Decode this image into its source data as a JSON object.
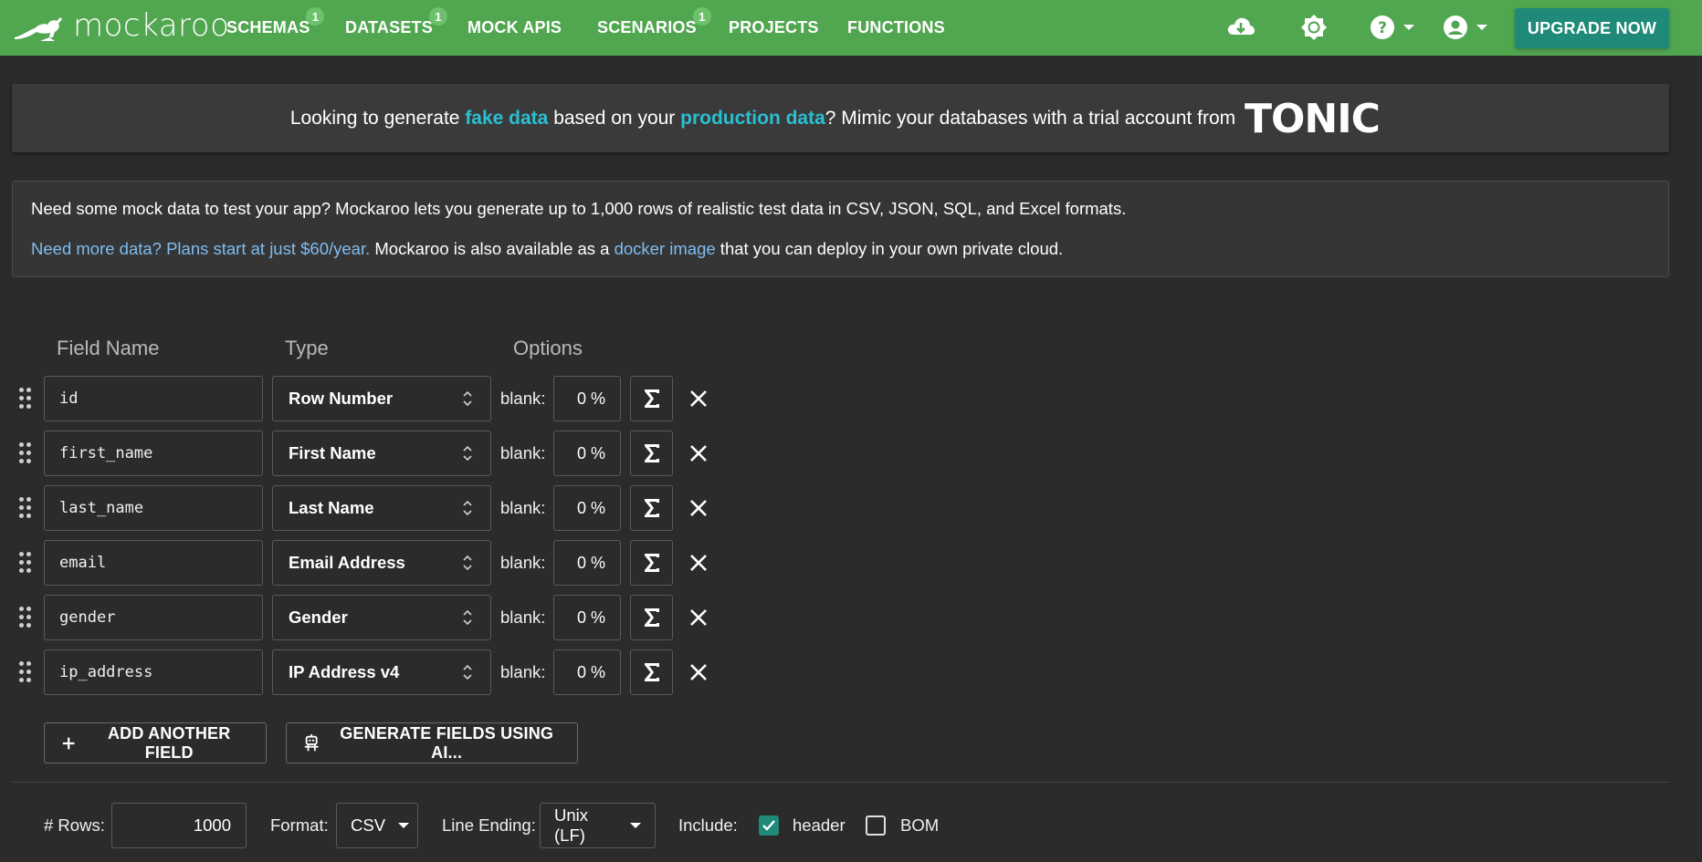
{
  "app": {
    "brand": "mockaroo"
  },
  "nav": {
    "items": [
      {
        "label": "SCHEMAS",
        "badge": "1"
      },
      {
        "label": "DATASETS",
        "badge": "1"
      },
      {
        "label": "MOCK APIS"
      },
      {
        "label": "SCENARIOS",
        "badge": "1"
      },
      {
        "label": "PROJECTS"
      },
      {
        "label": "FUNCTIONS"
      }
    ],
    "upgrade_label": "UPGRADE NOW"
  },
  "banner": {
    "text_1": "Looking to generate ",
    "highlight_1": "fake data",
    "text_2": " based on your ",
    "highlight_2": "production data",
    "text_3": "? Mimic your databases with a trial account from",
    "logo_text": "TONIC"
  },
  "info": {
    "line1": "Need some mock data to test your app? Mockaroo lets you generate up to 1,000 rows of realistic test data in CSV, JSON, SQL, and Excel formats.",
    "link_plans": "Need more data? Plans start at just $60/year.",
    "text_mid": " Mockaroo is also available as a ",
    "link_docker": "docker image",
    "text_end": " that you can deploy in your own private cloud."
  },
  "grid": {
    "headers": {
      "field_name": "Field Name",
      "type": "Type",
      "options": "Options"
    },
    "blank_label": "blank:",
    "fields": [
      {
        "name": "id",
        "type": "Row Number",
        "blank": "0 %"
      },
      {
        "name": "first_name",
        "type": "First Name",
        "blank": "0 %"
      },
      {
        "name": "last_name",
        "type": "Last Name",
        "blank": "0 %"
      },
      {
        "name": "email",
        "type": "Email Address",
        "blank": "0 %"
      },
      {
        "name": "gender",
        "type": "Gender",
        "blank": "0 %"
      },
      {
        "name": "ip_address",
        "type": "IP Address v4",
        "blank": "0 %"
      }
    ],
    "add_field_label": "ADD ANOTHER FIELD",
    "generate_ai_label": "GENERATE FIELDS USING AI..."
  },
  "options": {
    "rows_label": "# Rows:",
    "rows_value": "1000",
    "format_label": "Format:",
    "format_value": "CSV",
    "line_ending_label": "Line Ending:",
    "line_ending_value": "Unix (LF)",
    "include_label": "Include:",
    "header_label": "header",
    "header_checked": true,
    "bom_label": "BOM",
    "bom_checked": false
  },
  "colors": {
    "nav_bg": "#51a650",
    "accent": "#1f8a78",
    "highlight": "#2bbfd2",
    "link": "#7fbcf1"
  },
  "icons": [
    "kangaroo-logo",
    "cloud-download-icon",
    "brightness-icon",
    "help-icon",
    "account-icon",
    "drag-handle-icon",
    "sigma-icon",
    "close-icon",
    "plus-icon",
    "robot-icon"
  ]
}
